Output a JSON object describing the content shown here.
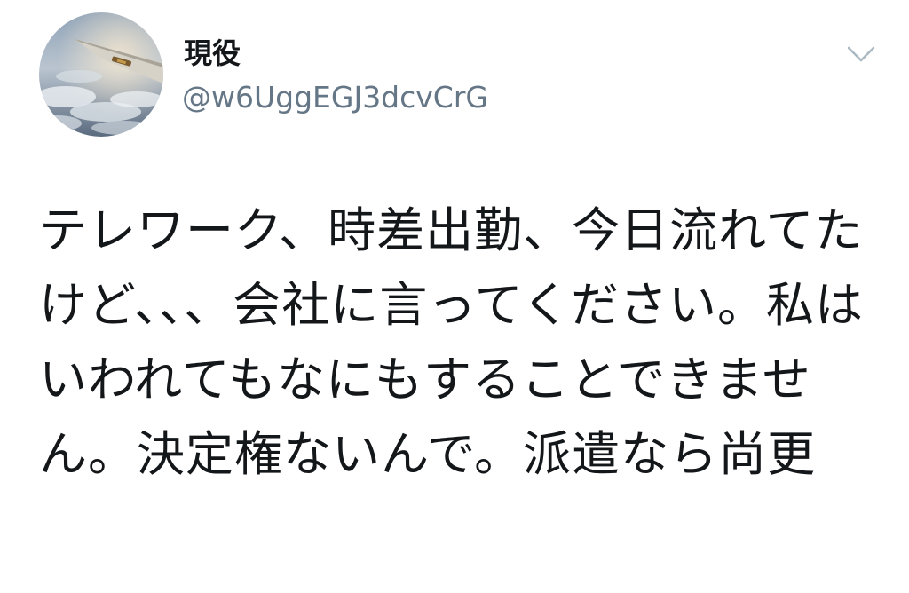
{
  "tweet": {
    "author": {
      "display_name": "現役",
      "handle": "@w6UggEGJ3dcvCrG",
      "avatar_icon": "profile-photo-airplane-wing-clouds"
    },
    "menu_icon": "chevron-down-icon",
    "text": "テレワーク、時差出勤、今日流れてたけど、、、会社に言ってください。私はいわれてもなにもすることできません。決定権ないんで。派遣なら尚更"
  },
  "colors": {
    "text_primary": "#14171a",
    "text_secondary": "#657786",
    "caret": "#aab8c2"
  }
}
